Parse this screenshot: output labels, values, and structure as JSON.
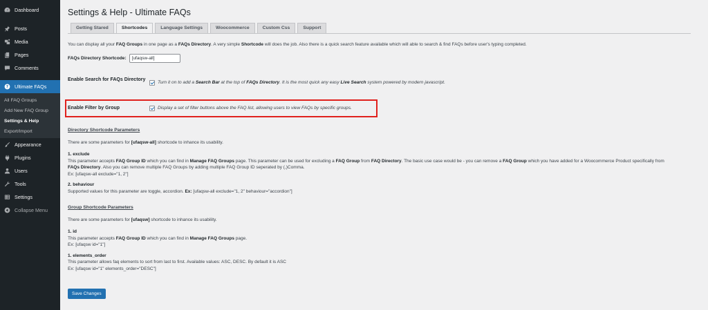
{
  "sidebar": {
    "dashboard": "Dashboard",
    "posts": "Posts",
    "media": "Media",
    "pages": "Pages",
    "comments": "Comments",
    "ultimate_faqs": "Ultimate FAQs",
    "sub_all_faq_groups": "All FAQ Groups",
    "sub_add_new_faq_group": "Add New FAQ Group",
    "sub_settings_help": "Settings & Help",
    "sub_export_import": "Export/Import",
    "appearance": "Appearance",
    "plugins": "Plugins",
    "users": "Users",
    "tools": "Tools",
    "settings": "Settings",
    "collapse": "Collapse Menu"
  },
  "page": {
    "title": "Settings & Help - Ultimate FAQs",
    "tabs": [
      {
        "label": "Getting Stared"
      },
      {
        "label": "Shortcodes"
      },
      {
        "label": "Language Settings"
      },
      {
        "label": "Woocommerce"
      },
      {
        "label": "Custom Css"
      },
      {
        "label": "Support"
      }
    ]
  },
  "intro": {
    "p1": "You can display all your ",
    "b1": "FAQ Groups",
    "p2": " in one page as a ",
    "b2": "FAQs Directory",
    "p3": ". A very simple ",
    "b3": "Shortcode",
    "p4": " will does the job. Also there is a quick search feature available which will able to search & find FAQs before user's typing completed."
  },
  "directory_shortcode": {
    "label": "FAQs Directory Shortcode:",
    "value": "[ufaqsw-all]"
  },
  "options": {
    "search": {
      "label": "Enable Search for FAQs Directory",
      "t1": "Turn it on to add a ",
      "b1": "Search Bar",
      "t2": " at the top of ",
      "b2": "FAQs Directory",
      "t3": ". It is the most quick any easy ",
      "b3": "Live Search",
      "t4": " system powered by modern javascript."
    },
    "filter": {
      "label": "Enable Filter by Group",
      "desc": "Display a set of filter buttons above the FAQ list, allowing users to view FAQs by specific groups."
    }
  },
  "directory_params": {
    "heading": "Directory Shortcode Parameters",
    "intro_a": "There are some parameters for ",
    "intro_b": "[ufaqsw-all]",
    "intro_c": " shortcode to inhance its usability.",
    "exclude_title": "1. exclude",
    "exclude_a": "This parameter accepts ",
    "exclude_b": "FAQ Group ID",
    "exclude_c": " which you can find in ",
    "exclude_d": "Manage FAQ Groups",
    "exclude_e": " page. This parameter can be used for excluding a ",
    "exclude_f": "FAQ Group",
    "exclude_g": " from ",
    "exclude_h": "FAQ Directory",
    "exclude_i": ". The basic use case would be - you can remove a ",
    "exclude_j": "FAQ Group",
    "exclude_k": " which you have added for a Woocommerce Product specifically from",
    "exclude_l": "FAQs Directory",
    "exclude_m": ". Also you can remove multiple FAQ Groups by adding multiple FAQ Group ID seperated by (,)Comma.",
    "exclude_ex": "Ex: [ufaqsw-all exclude=\"1, 2\"]",
    "behaviour_title": "2. behaviour",
    "behaviour_a": "Supported values for this parameter are toggle, accordion. ",
    "behaviour_b": "Ex:",
    "behaviour_c": " [ufaqsw-all exclude=\"1, 2\" behaviour=\"accordion\"]"
  },
  "group_params": {
    "heading": "Group Shortcode Parameters",
    "intro_a": "There are some parameters for ",
    "intro_b": "[ufaqsw]",
    "intro_c": " shortcode to inhance its usability.",
    "id_title": "1. id",
    "id_a": "This parameter accepts ",
    "id_b": "FAQ Group ID",
    "id_c": " which you can find in ",
    "id_d": "Manage FAQ Groups",
    "id_e": " page.",
    "id_ex": "Ex: [ufaqsw id=\"1\"]",
    "order_title": "1. elements_order",
    "order_desc": "This parameter allows faq elements to sort from last to first. Available values: ASC, DESC. By default it is ASC",
    "order_ex": "Ex: [ufaqsw id=\"1\" elements_order=\"DESC\"]"
  },
  "save_label": "Save Changes",
  "colors": {
    "accent": "#2271b1",
    "sidebar": "#1d2327",
    "highlight": "#e0201c"
  }
}
